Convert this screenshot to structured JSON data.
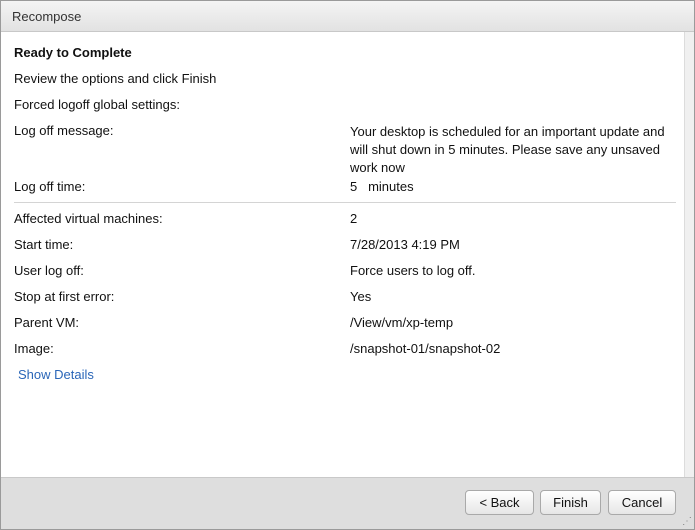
{
  "window": {
    "title": "Recompose"
  },
  "main": {
    "heading": "Ready to Complete",
    "intro": "Review the options and click Finish",
    "section_label": "Forced logoff global settings:",
    "logoff_message": {
      "label": "Log off message:",
      "value": "Your desktop is scheduled for an important update and will shut down in 5 minutes. Please save any unsaved work now"
    },
    "logoff_time": {
      "label": "Log off time:",
      "value": "5",
      "unit": "minutes"
    },
    "details": [
      {
        "label": "Affected virtual machines:",
        "value": "2"
      },
      {
        "label": "Start time:",
        "value": "7/28/2013 4:19 PM"
      },
      {
        "label": "User log off:",
        "value": "Force users to log off."
      },
      {
        "label": "Stop at first error:",
        "value": "Yes"
      },
      {
        "label": "Parent VM:",
        "value": "/View/vm/xp-temp"
      },
      {
        "label": "Image:",
        "value": "/snapshot-01/snapshot-02"
      }
    ],
    "show_details_link": "Show Details"
  },
  "footer": {
    "back_label": "< Back",
    "finish_label": "Finish",
    "cancel_label": "Cancel"
  },
  "colors": {
    "link": "#2a66b8",
    "footer_bg": "#dedede"
  }
}
